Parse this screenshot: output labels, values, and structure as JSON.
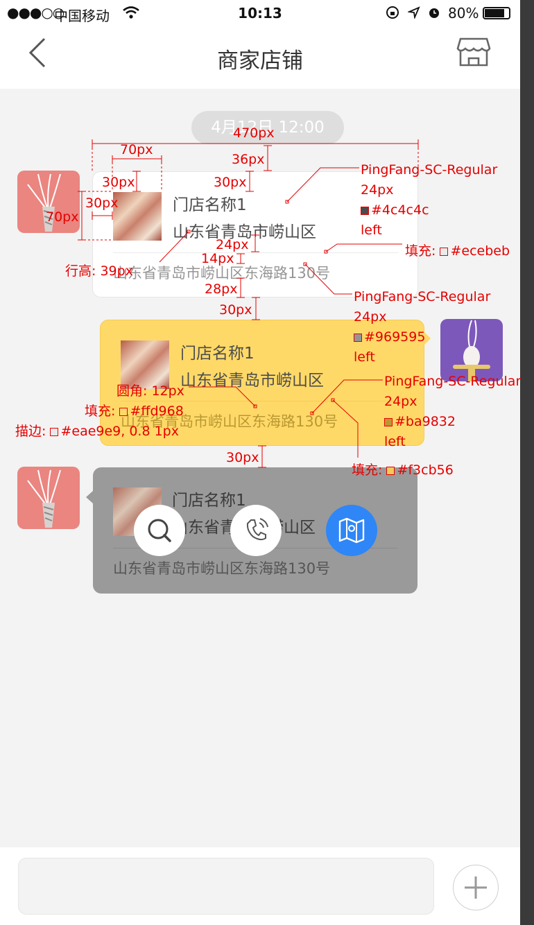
{
  "status_bar": {
    "signal": "●●●○○",
    "carrier": "中国移动",
    "time": "10:13",
    "battery": "80%"
  },
  "nav": {
    "back_icon": "chevron-left-icon",
    "title": "商家店铺",
    "store_icon": "store-icon"
  },
  "timestamp": "4月12日 12:00",
  "cards": [
    {
      "name": "门店名称1",
      "area": "山东省青岛市崂山区",
      "address": "山东省青岛市崂山区东海路130号",
      "side": "left"
    },
    {
      "name": "门店名称1",
      "area": "山东省青岛市崂山区",
      "address": "山东省青岛市崂山区东海路130号",
      "side": "right"
    },
    {
      "name": "门店名称1",
      "area": "山东省青岛市崂山区",
      "address": "山东省青岛市崂山区东海路130号",
      "side": "left"
    }
  ],
  "action_buttons": [
    {
      "icon": "search-icon"
    },
    {
      "icon": "phone-icon"
    },
    {
      "icon": "map-icon"
    }
  ],
  "annotations": {
    "w470": "470px",
    "w70": "70px",
    "h36": "36px",
    "h30a": "30px",
    "h30b": "30px",
    "h30c": "30px",
    "h70": "70px",
    "h24": "24px",
    "h14": "14px",
    "h28": "28px",
    "h30d": "30px",
    "h30e": "30px",
    "lineheight": "行高: 39px",
    "font1": [
      "PingFang-SC-Regular",
      "24px",
      "#4c4c4c",
      "left"
    ],
    "fill1": "填充: ",
    "fill1_color": "#ecebeb",
    "font2": [
      "PingFang-SC-Regular",
      "24px",
      "#969595",
      "left"
    ],
    "font3": [
      "PingFang-SC-Regular",
      "24px",
      "#ba9832",
      "left"
    ],
    "radius": "圆角: 12px",
    "fill2": "填充: ",
    "fill2_color": "#ffd968",
    "stroke": "描边: ",
    "stroke_value": "#eae9e9, 0.8 1px",
    "fill3": "填充: ",
    "fill3_color": "#f3cb56"
  },
  "colors": {
    "card_yellow": "#ffd968",
    "yellow_border": "#f3cb56",
    "map_button": "#2f86f6",
    "annotation": "#e60000"
  }
}
